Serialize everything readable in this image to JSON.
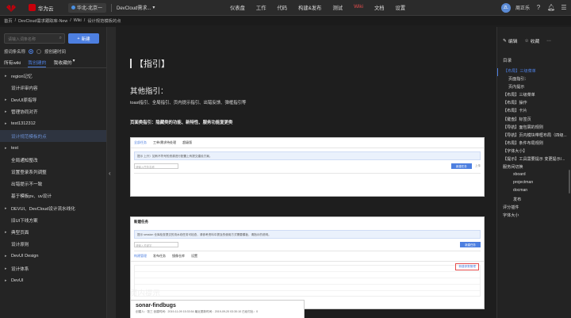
{
  "topbar": {
    "brand": "华为云",
    "region": "华北-北京一",
    "project": "DevCloud需求...",
    "nav": [
      "仪表盘",
      "工作",
      "代码",
      "构建&发布",
      "测试",
      "Wiki",
      "文档",
      "设置"
    ],
    "active_nav_index": 5,
    "user": "周正乐",
    "avatar_text": "ZL"
  },
  "breadcrumb": [
    "首页",
    "/",
    "DevCloud需求跟踪库-New",
    "/",
    "Wiki",
    "/",
    "设计规范模板的点"
  ],
  "sidebar": {
    "search_placeholder": "请输入词条名称",
    "new_button": "新建",
    "sort_by_name": "按词条名称",
    "sort_by_time": "按创建时间",
    "tabs": [
      "所有wiki",
      "我创建的",
      "我收藏的"
    ],
    "active_tab_index": 1,
    "items": [
      {
        "label": "region记忆",
        "chevron": true
      },
      {
        "label": "设计评审内容",
        "chevron": false
      },
      {
        "label": "DevUI原指导",
        "chevron": true
      },
      {
        "label": "管理协同对齐",
        "chevron": true
      },
      {
        "label": "test1312312",
        "chevron": true
      },
      {
        "label": "设计规范模板的点",
        "chevron": false,
        "selected": true
      },
      {
        "label": "test",
        "chevron": true
      },
      {
        "label": "全局通知整改",
        "chevron": false
      },
      {
        "label": "设置登录系列调整",
        "chevron": false
      },
      {
        "label": "出错提示不一致",
        "chevron": false
      },
      {
        "label": "基于模板pv、uv设计",
        "chevron": false
      },
      {
        "label": "DEVUI、DevCloud设计流水线化",
        "chevron": true
      },
      {
        "label": "旧UI下线方案",
        "chevron": false
      },
      {
        "label": "典型页面",
        "chevron": true
      },
      {
        "label": "设计原则",
        "chevron": false
      },
      {
        "label": "DevUI Design",
        "chevron": true
      },
      {
        "label": "设计体系",
        "chevron": true
      },
      {
        "label": "DevUI",
        "chevron": true
      }
    ]
  },
  "main": {
    "guide_heading": "【指引】",
    "other_heading": "其他指引：",
    "other_text": "toast指引、全局指引、页内提示指引、出错反馈、弹框指引等",
    "page_heading": "页面类指引：隐藏类的功能、新特性、服务功能复更类",
    "shot1": {
      "tabs": [
        "全部任务",
        "工单/需求待处理",
        "超级版"
      ],
      "info": "提示 上升）如有不符号的资源进行配置上有提交建设方案。",
      "input_placeholder": "请输入任务名称",
      "button": "新建任务",
      "link": "上传"
    },
    "shot2": {
      "title": "新建任务",
      "info": "提示 session 仓库检查提交的流水线任务可检查，请参考资料中提及的使用方式需要模板，请指示的说明。",
      "input_placeholder": "请输入关键字",
      "button": "新建任务",
      "tabs": [
        "构建管理",
        "发布任务",
        "镜像仓库",
        "设置"
      ],
      "highlight": "新建参数管理"
    },
    "inpage_heading": "页内提示",
    "shot3": {
      "title": "sonar-findbugs",
      "meta": "创建人：张三   创建时间：2019-11-09 15:33:54   最近更新时间：2019-09-20 03:30:10   已经付出：0"
    }
  },
  "rpanel": {
    "edit": "编辑",
    "favorite": "收藏",
    "toc_title": "目录",
    "toc": [
      {
        "label": "【布局】三级菜单",
        "level": 1,
        "active": true
      },
      {
        "label": "页面指引：",
        "level": 2
      },
      {
        "label": "页内提示",
        "level": 2
      },
      {
        "label": "【布局】三级菜单",
        "level": 1
      },
      {
        "label": "【布局】操作",
        "level": 1
      },
      {
        "label": "【布局】卡片",
        "level": 1
      },
      {
        "label": "【键盘】标签页",
        "level": 1
      },
      {
        "label": "【导航】面包屑的规则",
        "level": 1
      },
      {
        "label": "【导航】页内模块带框布局（四级...",
        "level": 1
      },
      {
        "label": "【布局】条件布局规则",
        "level": 1
      },
      {
        "label": "【字体大小】",
        "level": 1
      },
      {
        "label": "【提示】工具需要提示 变更提示/...",
        "level": 1
      },
      {
        "label": "服务间切换",
        "level": 1
      },
      {
        "label": "xboard",
        "level": 3
      },
      {
        "label": "projectman",
        "level": 3
      },
      {
        "label": "docman",
        "level": 3
      },
      {
        "label": "发布",
        "level": 3
      },
      {
        "label": "评分插件",
        "level": 1
      },
      {
        "label": "字体大小",
        "level": 1
      }
    ]
  },
  "colors": {
    "accent": "#4d7fe0",
    "nav_active": "#e54c4c",
    "brand": "#c7000b"
  }
}
